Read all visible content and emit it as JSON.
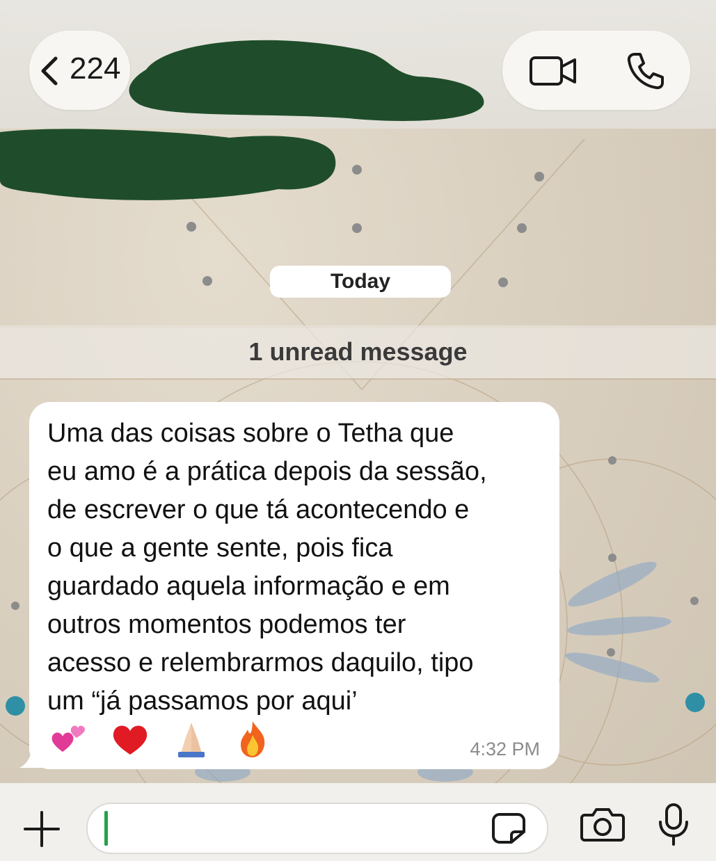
{
  "header": {
    "back_count": "224",
    "back_icon": "chevron-left-icon",
    "video_icon": "video-camera-icon",
    "call_icon": "phone-icon",
    "redaction_color": "#1f4d2b"
  },
  "chat": {
    "date_chip": "Today",
    "unread_banner": "1 unread message",
    "message": {
      "text": "Uma das coisas sobre o Tetha que\neu amo é a prática depois da sessão,\nde escrever o que tá acontecendo e\no que a gente sente, pois fica\nguardado aquela informação e em\noutros momentos podemos ter\nacesso e relembrarmos daquilo, tipo\num “já passamos por aqui’",
      "emojis": [
        "💕",
        "❤️",
        "🙏🏻",
        "🔥"
      ],
      "time": "4:32 PM"
    }
  },
  "input_bar": {
    "plus_icon": "plus-icon",
    "message_value": "",
    "sticker_icon": "sticker-icon",
    "camera_icon": "camera-icon",
    "mic_icon": "microphone-icon",
    "caret_color": "#25a24a"
  }
}
